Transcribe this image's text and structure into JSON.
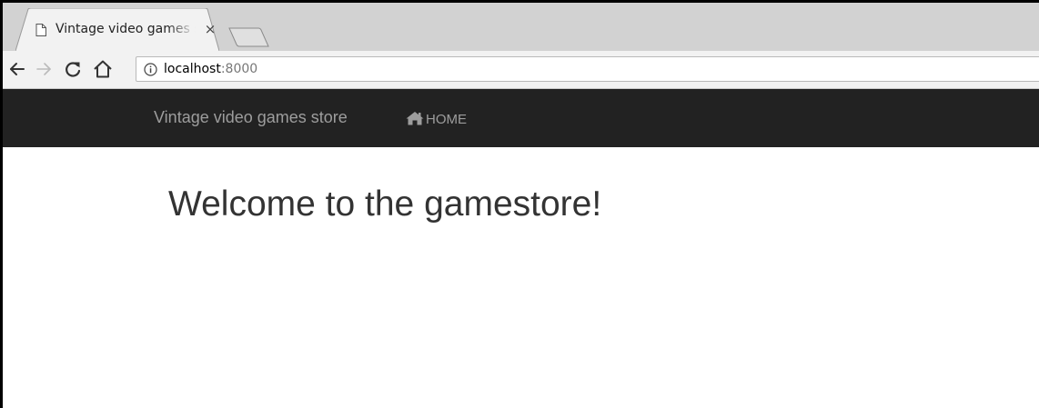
{
  "browser": {
    "tab": {
      "title": "Vintage video games store",
      "close_glyph": "×",
      "icon": "document-icon"
    },
    "toolbar": {
      "back_icon": "arrow-left-icon",
      "forward_icon": "arrow-right-icon",
      "reload_icon": "reload-icon",
      "home_icon": "home-icon"
    },
    "address": {
      "host": "localhost",
      "port": ":8000",
      "info_icon": "info-icon"
    }
  },
  "page": {
    "navbar": {
      "brand": "Vintage video games store",
      "home_label": "HOME",
      "home_icon": "home-icon",
      "background": "#222222",
      "text_color": "#9d9d9d"
    },
    "heading": "Welcome to the gamestore!"
  }
}
